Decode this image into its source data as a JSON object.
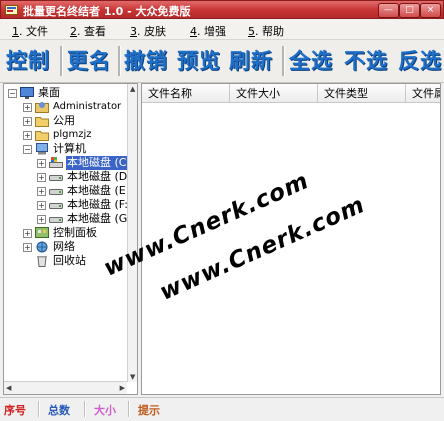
{
  "window": {
    "title": "批量更名终结者 1.0 - 大众免费版",
    "min_label": "—",
    "max_label": "□",
    "close_label": "×"
  },
  "menu": [
    {
      "key": "1",
      "label": "文件"
    },
    {
      "key": "2",
      "label": "查看"
    },
    {
      "key": "3",
      "label": "皮肤"
    },
    {
      "key": "4",
      "label": "增强"
    },
    {
      "key": "5",
      "label": "帮助"
    }
  ],
  "toolbar": {
    "control": "控制",
    "rename": "更名",
    "undo": "撤销",
    "preview": "预览",
    "refresh": "刷新",
    "select_all": "全选",
    "select_none": "不选",
    "invert": "反选"
  },
  "tree": {
    "desktop": "桌面",
    "administrator": "Administrator",
    "public": "公用",
    "user": "plgmzjz",
    "computer": "计算机",
    "drives": [
      "本地磁盘 (C:",
      "本地磁盘 (D:",
      "本地磁盘 (E:",
      "本地磁盘 (F:",
      "本地磁盘 (G:"
    ],
    "control_panel": "控制面板",
    "network": "网络",
    "recycle_bin": "回收站"
  },
  "list": {
    "columns": [
      "文件名称",
      "文件大小",
      "文件类型",
      "文件属"
    ]
  },
  "status": {
    "index": "序号",
    "total": "总数",
    "size": "大小",
    "hint": "提示",
    "colors": {
      "index": "#d02020",
      "total": "#2a5ab8",
      "size": "#d060d0",
      "hint": "#c05a1a"
    }
  },
  "watermark": {
    "text1": "www.Cnerk.com",
    "text2": "www.Cnerk.com"
  },
  "colors": {
    "titlebar": "#c83434",
    "toolbar_text": "#1f6fc9",
    "selection": "#3a64c8"
  }
}
